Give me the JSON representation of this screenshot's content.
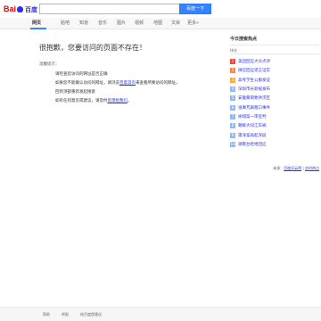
{
  "header": {
    "logo": {
      "bai": "Bai",
      "du": "du",
      "cn": "百度"
    },
    "search_placeholder": "",
    "search_button": "百度一下"
  },
  "nav": {
    "items": [
      "网页",
      "贴吧",
      "知道",
      "音乐",
      "图片",
      "视频",
      "地图",
      "文库",
      "更多»"
    ],
    "active_index": 0
  },
  "main": {
    "error_title": "很抱歉，您要访问的页面不存在！",
    "hint_heading": "温馨提示：",
    "tips": [
      {
        "text": "请检查您访问的网址是否正确"
      },
      {
        "before": "如果您不能确认访问的网址，请浏览",
        "link": "百度首页",
        "after": "来查看所要访问的网址。"
      },
      {
        "text": "回到顶部重新发起搜索"
      },
      {
        "before": "如有任何意见或建议，请及时",
        "link": "反馈给我们",
        "after": "。"
      }
    ]
  },
  "side": {
    "title": "今日搜索热点",
    "subtitle": "排名",
    "hot_items": [
      {
        "rank": "1",
        "text": "美团回应大众点评"
      },
      {
        "rank": "2",
        "text": "微信回应谣言证实"
      },
      {
        "rank": "3",
        "text": "高考学生公服发证"
      },
      {
        "rank": "4",
        "text": "深圳市长新规发布"
      },
      {
        "rank": "5",
        "text": "安徽暴雨致洪涝区"
      },
      {
        "rank": "6",
        "text": "张琳芃飙粗口事件"
      },
      {
        "rank": "7",
        "text": "徐翔案一审宣判"
      },
      {
        "rank": "8",
        "text": "朝鲜大同江车祸"
      },
      {
        "rank": "9",
        "text": "雷洋案再起深层"
      },
      {
        "rank": "10",
        "text": "湖南台拒绝回应"
      }
    ],
    "footer_prefix": "来源：",
    "footer_links": [
      "百度风云榜",
      "实时热点"
    ]
  },
  "footer": {
    "links": [
      "帮助",
      "举报",
      "给百度提建议"
    ]
  },
  "colors": {
    "brand_red": "#e10602",
    "brand_blue": "#2932e1",
    "button_blue": "#3385ff",
    "rank1": "#f54545",
    "rank2": "#ff8547",
    "rank3": "#ffac38",
    "rank_other": "#8eb9f5"
  }
}
